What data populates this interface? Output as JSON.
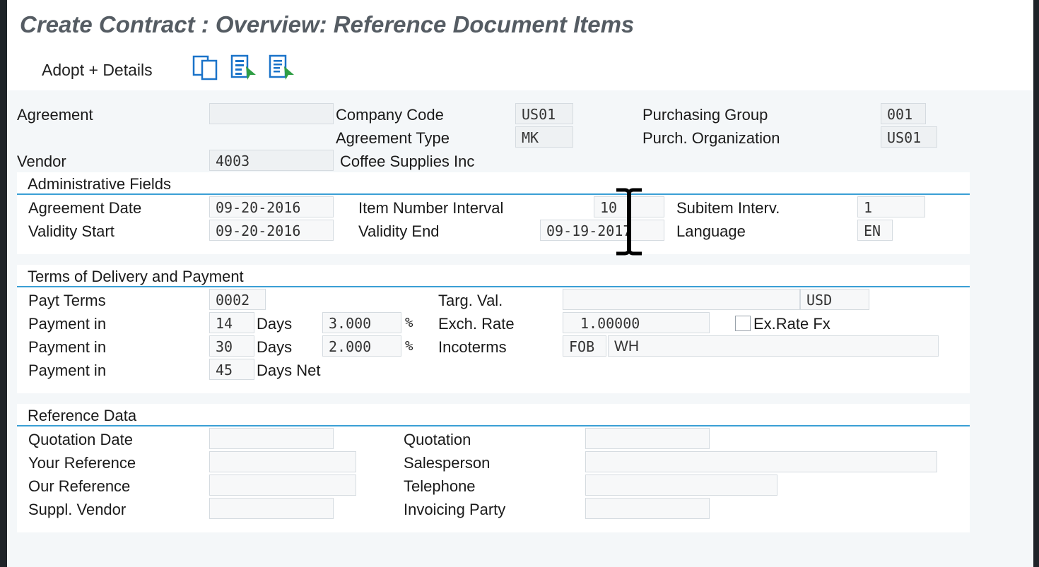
{
  "title": "Create Contract : Overview: Reference Document Items",
  "toolbar": {
    "adopt_label": "Adopt + Details",
    "icons": [
      "copy-icon",
      "select-all-icon",
      "deselect-all-icon"
    ]
  },
  "header": {
    "agreement_label": "Agreement",
    "agreement_value": "",
    "company_code_label": "Company Code",
    "company_code_value": "US01",
    "agreement_type_label": "Agreement Type",
    "agreement_type_value": "MK",
    "purch_group_label": "Purchasing Group",
    "purch_group_value": "001",
    "purch_org_label": "Purch. Organization",
    "purch_org_value": "US01",
    "vendor_label": "Vendor",
    "vendor_value": "4003",
    "vendor_name": "Coffee Supplies Inc"
  },
  "admin": {
    "title": "Administrative Fields",
    "agreement_date_label": "Agreement Date",
    "agreement_date_value": "09-20-2016",
    "validity_start_label": "Validity Start",
    "validity_start_value": "09-20-2016",
    "item_interval_label": "Item Number Interval",
    "item_interval_value": "10",
    "validity_end_label": "Validity End",
    "validity_end_value": "09-19-2017",
    "subitem_label": "Subitem Interv.",
    "subitem_value": "1",
    "language_label": "Language",
    "language_value": "EN"
  },
  "terms": {
    "title": "Terms of Delivery and Payment",
    "payt_terms_label": "Payt Terms",
    "payt_terms_value": "0002",
    "payment_in_label": "Payment in",
    "days_label": "Days",
    "days_net_label": "Days Net",
    "percent": "%",
    "pay1_days": "14",
    "pay1_pct": "3.000",
    "pay2_days": "30",
    "pay2_pct": "2.000",
    "pay3_days": "45",
    "targ_val_label": "Targ. Val.",
    "targ_val_value": "",
    "currency": "USD",
    "exch_rate_label": "Exch. Rate",
    "exch_rate_value": "1.00000",
    "exrate_fx_label": "Ex.Rate Fx",
    "exrate_fx_checked": false,
    "incoterms_label": "Incoterms",
    "incoterms_code": "FOB",
    "incoterms_text": "WH"
  },
  "reference": {
    "title": "Reference Data",
    "quotation_date_label": "Quotation Date",
    "your_reference_label": "Your Reference",
    "our_reference_label": "Our Reference",
    "suppl_vendor_label": "Suppl. Vendor",
    "quotation_label": "Quotation",
    "salesperson_label": "Salesperson",
    "telephone_label": "Telephone",
    "invoicing_party_label": "Invoicing Party"
  },
  "colors": {
    "accent_line": "#3a9fd5",
    "icon_blue": "#1a73c9",
    "icon_green": "#2f9e44"
  }
}
